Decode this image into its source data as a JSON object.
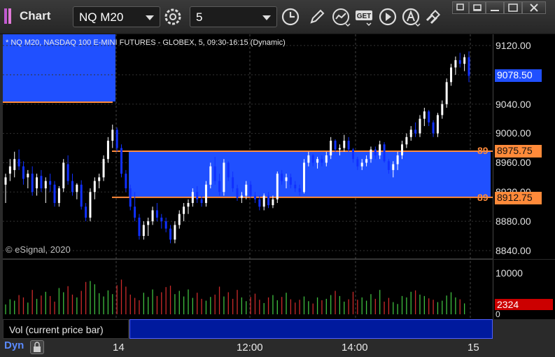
{
  "app": {
    "title": "Chart"
  },
  "toolbar": {
    "symbol": "NQ M20",
    "interval": "5",
    "icons": [
      "settings-icon",
      "clock-icon",
      "pencil-icon",
      "study-icon",
      "get-icon",
      "play-icon",
      "alert-icon",
      "link-icon"
    ]
  },
  "window": {
    "buttons": [
      "restore",
      "minimize",
      "maximize",
      "close"
    ]
  },
  "chart": {
    "title": "* NQ M20, NASDAQ 100 E-MINI FUTURES - GLOBEX, 5, 09:30-16:15 (Dynamic)",
    "watermark": "© eSignal, 2020",
    "price_ticks": [
      "9120.00",
      "9040.00",
      "9000.00",
      "8960.00",
      "8920.00",
      "8880.00",
      "8840.00"
    ],
    "last_price": "9078.50",
    "line_upper": {
      "prefix": "89",
      "price": "8975.75"
    },
    "line_lower": {
      "prefix": "89",
      "price": "8912.75"
    },
    "colors": {
      "up": "#ffffff",
      "down": "#1030ff",
      "zone": "#2050ff",
      "line": "#ff8a3a",
      "last_bg": "#2050ff"
    }
  },
  "volume": {
    "legend": "Vol (current price bar)",
    "close_glyph": "×",
    "scale_max": "10000",
    "scale_min": "0",
    "last_value": "2324",
    "colors": {
      "up": "#3fbf3f",
      "down": "#cc2a2a",
      "last_bg": "#cc0000"
    }
  },
  "time_axis": {
    "mode": "Dyn",
    "labels": [
      "14",
      "12:00",
      "14:00",
      "15"
    ]
  },
  "chart_data": {
    "type": "candlestick",
    "title": "* NQ M20, NASDAQ 100 E-MINI FUTURES - GLOBEX, 5, 09:30-16:15 (Dynamic)",
    "ylim": [
      8830,
      9135
    ],
    "bars": [
      {
        "o": 8930,
        "h": 8945,
        "l": 8905,
        "c": 8940
      },
      {
        "o": 8945,
        "h": 8965,
        "l": 8935,
        "c": 8955
      },
      {
        "o": 8950,
        "h": 8975,
        "l": 8940,
        "c": 8965
      },
      {
        "o": 8965,
        "h": 8978,
        "l": 8950,
        "c": 8955
      },
      {
        "o": 8955,
        "h": 8962,
        "l": 8930,
        "c": 8938
      },
      {
        "o": 8940,
        "h": 8950,
        "l": 8925,
        "c": 8945
      },
      {
        "o": 8945,
        "h": 8955,
        "l": 8915,
        "c": 8920
      },
      {
        "o": 8925,
        "h": 8945,
        "l": 8915,
        "c": 8940
      },
      {
        "o": 8942,
        "h": 8950,
        "l": 8920,
        "c": 8925
      },
      {
        "o": 8925,
        "h": 8940,
        "l": 8905,
        "c": 8935
      },
      {
        "o": 8935,
        "h": 8945,
        "l": 8920,
        "c": 8930
      },
      {
        "o": 8930,
        "h": 8935,
        "l": 8900,
        "c": 8905
      },
      {
        "o": 8905,
        "h": 8928,
        "l": 8900,
        "c": 8925
      },
      {
        "o": 8925,
        "h": 8965,
        "l": 8920,
        "c": 8960
      },
      {
        "o": 8958,
        "h": 8970,
        "l": 8930,
        "c": 8935
      },
      {
        "o": 8935,
        "h": 8945,
        "l": 8915,
        "c": 8920
      },
      {
        "o": 8920,
        "h": 8932,
        "l": 8910,
        "c": 8930
      },
      {
        "o": 8930,
        "h": 8936,
        "l": 8896,
        "c": 8900
      },
      {
        "o": 8900,
        "h": 8905,
        "l": 8880,
        "c": 8885
      },
      {
        "o": 8885,
        "h": 8925,
        "l": 8880,
        "c": 8920
      },
      {
        "o": 8920,
        "h": 8940,
        "l": 8910,
        "c": 8935
      },
      {
        "o": 8935,
        "h": 8945,
        "l": 8925,
        "c": 8940
      },
      {
        "o": 8940,
        "h": 8970,
        "l": 8935,
        "c": 8965
      },
      {
        "o": 8965,
        "h": 8995,
        "l": 8960,
        "c": 8990
      },
      {
        "o": 8990,
        "h": 9012,
        "l": 8980,
        "c": 9005
      },
      {
        "o": 9005,
        "h": 9008,
        "l": 8975,
        "c": 8980
      },
      {
        "o": 8980,
        "h": 8985,
        "l": 8940,
        "c": 8945
      },
      {
        "o": 8945,
        "h": 8950,
        "l": 8920,
        "c": 8925
      },
      {
        "o": 8925,
        "h": 8930,
        "l": 8895,
        "c": 8900
      },
      {
        "o": 8900,
        "h": 8920,
        "l": 8880,
        "c": 8885
      },
      {
        "o": 8885,
        "h": 8890,
        "l": 8855,
        "c": 8860
      },
      {
        "o": 8860,
        "h": 8880,
        "l": 8855,
        "c": 8875
      },
      {
        "o": 8875,
        "h": 8885,
        "l": 8860,
        "c": 8880
      },
      {
        "o": 8880,
        "h": 8900,
        "l": 8875,
        "c": 8895
      },
      {
        "o": 8895,
        "h": 8905,
        "l": 8880,
        "c": 8885
      },
      {
        "o": 8885,
        "h": 8890,
        "l": 8870,
        "c": 8880
      },
      {
        "o": 8880,
        "h": 8885,
        "l": 8865,
        "c": 8870
      },
      {
        "o": 8870,
        "h": 8875,
        "l": 8850,
        "c": 8855
      },
      {
        "o": 8855,
        "h": 8880,
        "l": 8850,
        "c": 8875
      },
      {
        "o": 8875,
        "h": 8895,
        "l": 8870,
        "c": 8890
      },
      {
        "o": 8890,
        "h": 8905,
        "l": 8880,
        "c": 8900
      },
      {
        "o": 8900,
        "h": 8910,
        "l": 8890,
        "c": 8905
      },
      {
        "o": 8905,
        "h": 8925,
        "l": 8900,
        "c": 8920
      },
      {
        "o": 8920,
        "h": 8928,
        "l": 8905,
        "c": 8910
      },
      {
        "o": 8910,
        "h": 8915,
        "l": 8900,
        "c": 8905
      },
      {
        "o": 8905,
        "h": 8935,
        "l": 8900,
        "c": 8930
      },
      {
        "o": 8930,
        "h": 8960,
        "l": 8925,
        "c": 8955
      },
      {
        "o": 8955,
        "h": 8968,
        "l": 8930,
        "c": 8935
      },
      {
        "o": 8935,
        "h": 8945,
        "l": 8915,
        "c": 8920
      },
      {
        "o": 8920,
        "h": 8965,
        "l": 8915,
        "c": 8960
      },
      {
        "o": 8960,
        "h": 8962,
        "l": 8935,
        "c": 8940
      },
      {
        "o": 8940,
        "h": 8948,
        "l": 8920,
        "c": 8925
      },
      {
        "o": 8925,
        "h": 8930,
        "l": 8908,
        "c": 8912
      },
      {
        "o": 8912,
        "h": 8920,
        "l": 8905,
        "c": 8915
      },
      {
        "o": 8915,
        "h": 8935,
        "l": 8910,
        "c": 8930
      },
      {
        "o": 8930,
        "h": 8935,
        "l": 8912,
        "c": 8915
      },
      {
        "o": 8915,
        "h": 8920,
        "l": 8905,
        "c": 8910
      },
      {
        "o": 8910,
        "h": 8915,
        "l": 8895,
        "c": 8900
      },
      {
        "o": 8900,
        "h": 8918,
        "l": 8895,
        "c": 8915
      },
      {
        "o": 8915,
        "h": 8920,
        "l": 8898,
        "c": 8902
      },
      {
        "o": 8902,
        "h": 8915,
        "l": 8898,
        "c": 8910
      },
      {
        "o": 8910,
        "h": 8948,
        "l": 8905,
        "c": 8945
      },
      {
        "o": 8945,
        "h": 8950,
        "l": 8930,
        "c": 8935
      },
      {
        "o": 8935,
        "h": 8945,
        "l": 8925,
        "c": 8940
      },
      {
        "o": 8940,
        "h": 8945,
        "l": 8925,
        "c": 8930
      },
      {
        "o": 8930,
        "h": 8935,
        "l": 8920,
        "c": 8925
      },
      {
        "o": 8925,
        "h": 8930,
        "l": 8915,
        "c": 8920
      },
      {
        "o": 8920,
        "h": 8965,
        "l": 8918,
        "c": 8960
      },
      {
        "o": 8960,
        "h": 8975,
        "l": 8955,
        "c": 8970
      },
      {
        "o": 8970,
        "h": 8972,
        "l": 8955,
        "c": 8960
      },
      {
        "o": 8960,
        "h": 8968,
        "l": 8952,
        "c": 8965
      },
      {
        "o": 8965,
        "h": 8970,
        "l": 8955,
        "c": 8960
      },
      {
        "o": 8960,
        "h": 8975,
        "l": 8955,
        "c": 8970
      },
      {
        "o": 8970,
        "h": 8995,
        "l": 8965,
        "c": 8990
      },
      {
        "o": 8990,
        "h": 8992,
        "l": 8975,
        "c": 8978
      },
      {
        "o": 8978,
        "h": 8985,
        "l": 8970,
        "c": 8980
      },
      {
        "o": 8980,
        "h": 8998,
        "l": 8975,
        "c": 8990
      },
      {
        "o": 8990,
        "h": 8995,
        "l": 8975,
        "c": 8978
      },
      {
        "o": 8978,
        "h": 8980,
        "l": 8960,
        "c": 8965
      },
      {
        "o": 8965,
        "h": 8968,
        "l": 8950,
        "c": 8955
      },
      {
        "o": 8955,
        "h": 8965,
        "l": 8950,
        "c": 8960
      },
      {
        "o": 8960,
        "h": 8970,
        "l": 8955,
        "c": 8965
      },
      {
        "o": 8965,
        "h": 8982,
        "l": 8960,
        "c": 8978
      },
      {
        "o": 8978,
        "h": 8982,
        "l": 8965,
        "c": 8970
      },
      {
        "o": 8970,
        "h": 8990,
        "l": 8965,
        "c": 8985
      },
      {
        "o": 8985,
        "h": 8988,
        "l": 8960,
        "c": 8962
      },
      {
        "o": 8962,
        "h": 8965,
        "l": 8945,
        "c": 8950
      },
      {
        "o": 8950,
        "h": 8962,
        "l": 8940,
        "c": 8958
      },
      {
        "o": 8958,
        "h": 8975,
        "l": 8950,
        "c": 8970
      },
      {
        "o": 8970,
        "h": 8990,
        "l": 8965,
        "c": 8985
      },
      {
        "o": 8985,
        "h": 9000,
        "l": 8980,
        "c": 8995
      },
      {
        "o": 8995,
        "h": 9010,
        "l": 8990,
        "c": 9005
      },
      {
        "o": 9005,
        "h": 9015,
        "l": 8995,
        "c": 9000
      },
      {
        "o": 9000,
        "h": 9025,
        "l": 8995,
        "c": 9020
      },
      {
        "o": 9020,
        "h": 9035,
        "l": 9010,
        "c": 9030
      },
      {
        "o": 9030,
        "h": 9032,
        "l": 9010,
        "c": 9015
      },
      {
        "o": 9015,
        "h": 9018,
        "l": 8995,
        "c": 9000
      },
      {
        "o": 9000,
        "h": 9028,
        "l": 8995,
        "c": 9025
      },
      {
        "o": 9025,
        "h": 9045,
        "l": 9020,
        "c": 9040
      },
      {
        "o": 9040,
        "h": 9075,
        "l": 9035,
        "c": 9070
      },
      {
        "o": 9070,
        "h": 9095,
        "l": 9065,
        "c": 9090
      },
      {
        "o": 9090,
        "h": 9105,
        "l": 9080,
        "c": 9100
      },
      {
        "o": 9100,
        "h": 9110,
        "l": 9090,
        "c": 9095
      },
      {
        "o": 9095,
        "h": 9108,
        "l": 9085,
        "c": 9104
      },
      {
        "o": 9104,
        "h": 9112,
        "l": 9070,
        "c": 9078.5
      }
    ],
    "volume": [
      2100,
      3200,
      2900,
      4100,
      3600,
      2500,
      5200,
      3300,
      4000,
      4800,
      3900,
      2700,
      5600,
      4700,
      6000,
      4200,
      3600,
      5000,
      6900,
      7100,
      6400,
      4500,
      3800,
      5100,
      4300,
      6200,
      7400,
      5900,
      4200,
      3500,
      3000,
      4600,
      3700,
      5300,
      3900,
      4700,
      5800,
      6100,
      4300,
      5000,
      3800,
      5300,
      3500,
      4600,
      3300,
      2900,
      3700,
      4200,
      5900,
      3800,
      4700,
      3300,
      5200,
      3600,
      2800,
      3700,
      4400,
      3100,
      2400,
      3600,
      4100,
      3000,
      3700,
      4600,
      3200,
      2500,
      3100,
      3800,
      2800,
      2300,
      3600,
      3000,
      3300,
      4100,
      5000,
      3900,
      2700,
      3200,
      4800,
      3100,
      3600,
      2900,
      4300,
      3300,
      5200,
      2700,
      3500,
      2600,
      2200,
      3900,
      3600,
      4800,
      5100,
      4200,
      3900,
      3400,
      3100,
      2600,
      2900,
      4000,
      4700,
      3600,
      3200,
      2324
    ]
  }
}
